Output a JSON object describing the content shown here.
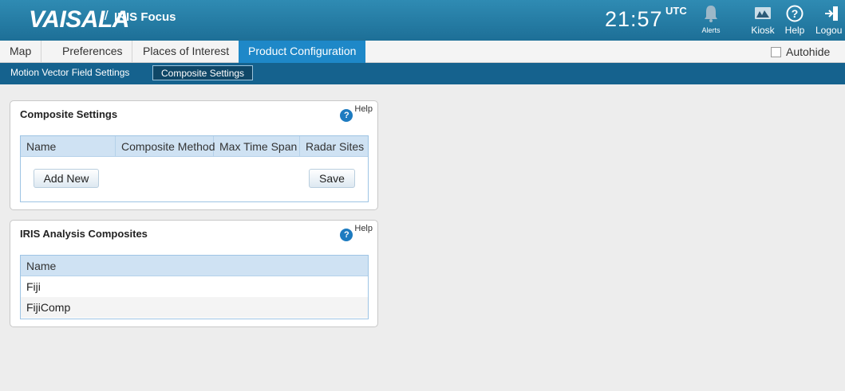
{
  "header": {
    "brand": "VAISALA",
    "slash": "/",
    "product": "IRIS Focus",
    "time": "21:57",
    "time_zone": "UTC",
    "buttons": {
      "alerts": "Alerts",
      "kiosk": "Kiosk",
      "help": "Help",
      "logout": "Logou"
    }
  },
  "tabs": [
    "Map",
    "Preferences",
    "Places of Interest",
    "Product Configuration"
  ],
  "active_tab": "Product Configuration",
  "autohide_label": "Autohide",
  "subtabs": [
    "Motion Vector Field Settings",
    "Composite Settings"
  ],
  "active_subtab": "Composite Settings",
  "composite_settings": {
    "title": "Composite Settings",
    "help_label": "Help",
    "columns": [
      "Name",
      "Composite Method",
      "Max Time Span",
      "Radar Sites"
    ],
    "add_new_label": "Add New",
    "save_label": "Save"
  },
  "iris_composites": {
    "title": "IRIS Analysis Composites",
    "help_label": "Help",
    "column": "Name",
    "rows": [
      "Fiji",
      "FijiComp"
    ]
  },
  "colors": {
    "header_blue": "#1d6f97",
    "active_tab": "#1e88c8",
    "subbar": "#15628e",
    "table_header": "#cfe2f3"
  }
}
